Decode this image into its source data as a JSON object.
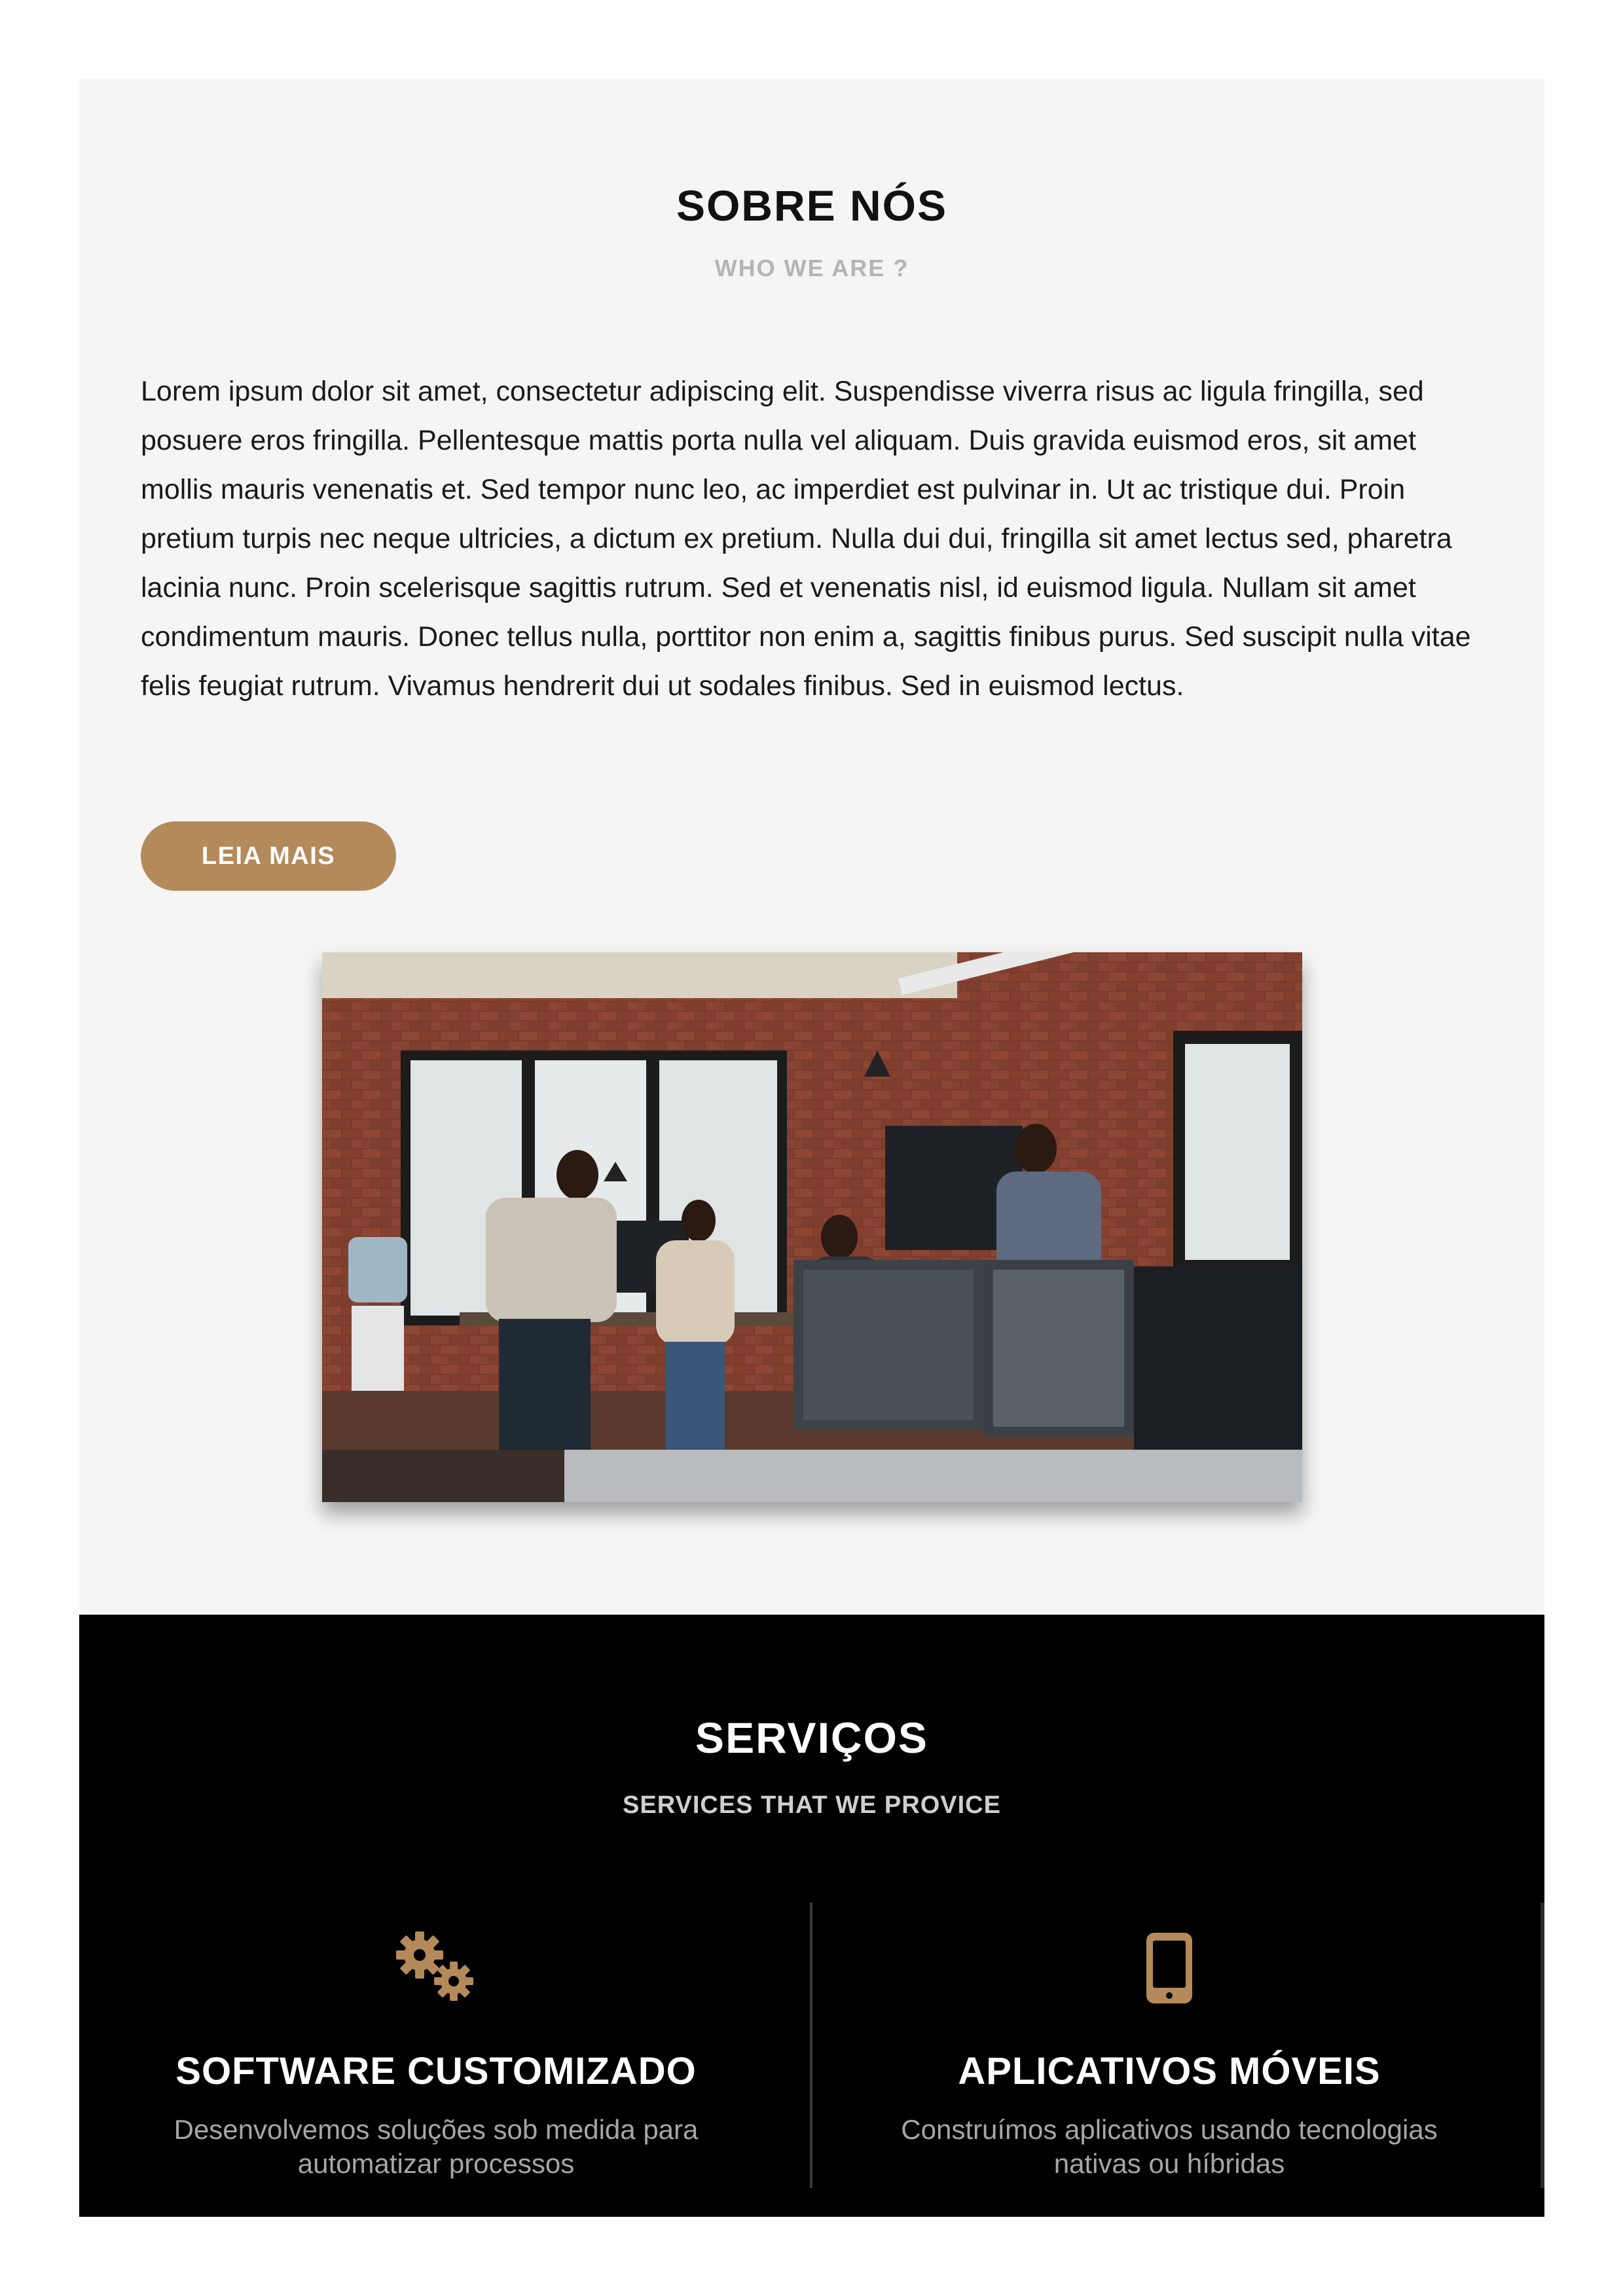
{
  "about": {
    "title": "SOBRE NÓS",
    "subtitle": "WHO WE ARE ?",
    "body": "Lorem ipsum dolor sit amet, consectetur adipiscing elit. Suspendisse viverra risus ac ligula fringilla, sed posuere eros fringilla. Pellentesque mattis porta nulla vel aliquam. Duis gravida euismod eros, sit amet mollis mauris venenatis et. Sed tempor nunc leo, ac imperdiet est pulvinar in. Ut ac tristique dui. Proin pretium turpis nec neque ultricies, a dictum ex pretium. Nulla dui dui, fringilla sit amet lectus sed, pharetra lacinia nunc. Proin scelerisque sagittis rutrum. Sed et venenatis nisl, id euismod ligula. Nullam sit amet condimentum mauris. Donec tellus nulla, porttitor non enim a, sagittis finibus purus. Sed suscipit nulla vitae felis feugiat rutrum. Vivamus hendrerit dui ut sodales finibus. Sed in euismod lectus.",
    "button_label": "LEIA MAIS"
  },
  "services": {
    "title": "SERVIÇOS",
    "subtitle": "SERVICES THAT WE PROVICE",
    "items": [
      {
        "icon": "gears-icon",
        "title": "SOFTWARE CUSTOMIZADO",
        "description": "Desenvolvemos soluções sob medida para automatizar processos"
      },
      {
        "icon": "mobile-phone-icon",
        "title": "APLICATIVOS MÓVEIS",
        "description": "Construímos aplicativos usando tecnologias nativas ou híbridas"
      }
    ]
  },
  "colors": {
    "accent": "#b48a5a",
    "about_background": "#f5f5f5",
    "services_background": "#000000"
  }
}
